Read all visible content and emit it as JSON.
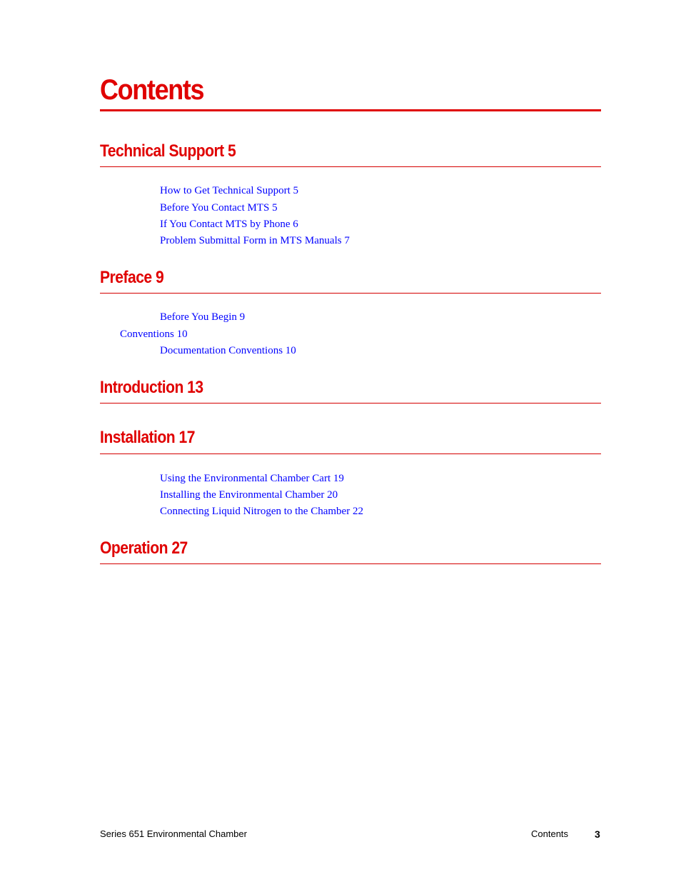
{
  "document": {
    "title": "Contents",
    "accent_color": "#e00000",
    "link_color": "#0000ff"
  },
  "sections": [
    {
      "heading": "Technical Support 5",
      "entries": [
        {
          "label": "How to Get Technical Support 5",
          "level": 2
        },
        {
          "label": "Before You Contact MTS 5",
          "level": 2
        },
        {
          "label": "If You Contact MTS by Phone 6",
          "level": 2
        },
        {
          "label": "Problem Submittal Form in MTS Manuals 7",
          "level": 2
        }
      ]
    },
    {
      "heading": "Preface 9",
      "entries": [
        {
          "label": "Before You Begin 9",
          "level": 2
        },
        {
          "label": "Conventions 10",
          "level": 1
        },
        {
          "label": "Documentation Conventions 10",
          "level": 2
        }
      ]
    },
    {
      "heading": "Introduction 13",
      "entries": []
    },
    {
      "heading": "Installation 17",
      "entries": [
        {
          "label": "Using the Environmental Chamber Cart 19",
          "level": 2
        },
        {
          "label": "Installing the Environmental Chamber 20",
          "level": 2
        },
        {
          "label": "Connecting Liquid Nitrogen to the Chamber 22",
          "level": 2
        }
      ]
    },
    {
      "heading": "Operation 27",
      "entries": []
    }
  ],
  "footer": {
    "document_name": "Series 651 Environmental Chamber",
    "section": "Contents",
    "page_number": "3"
  }
}
